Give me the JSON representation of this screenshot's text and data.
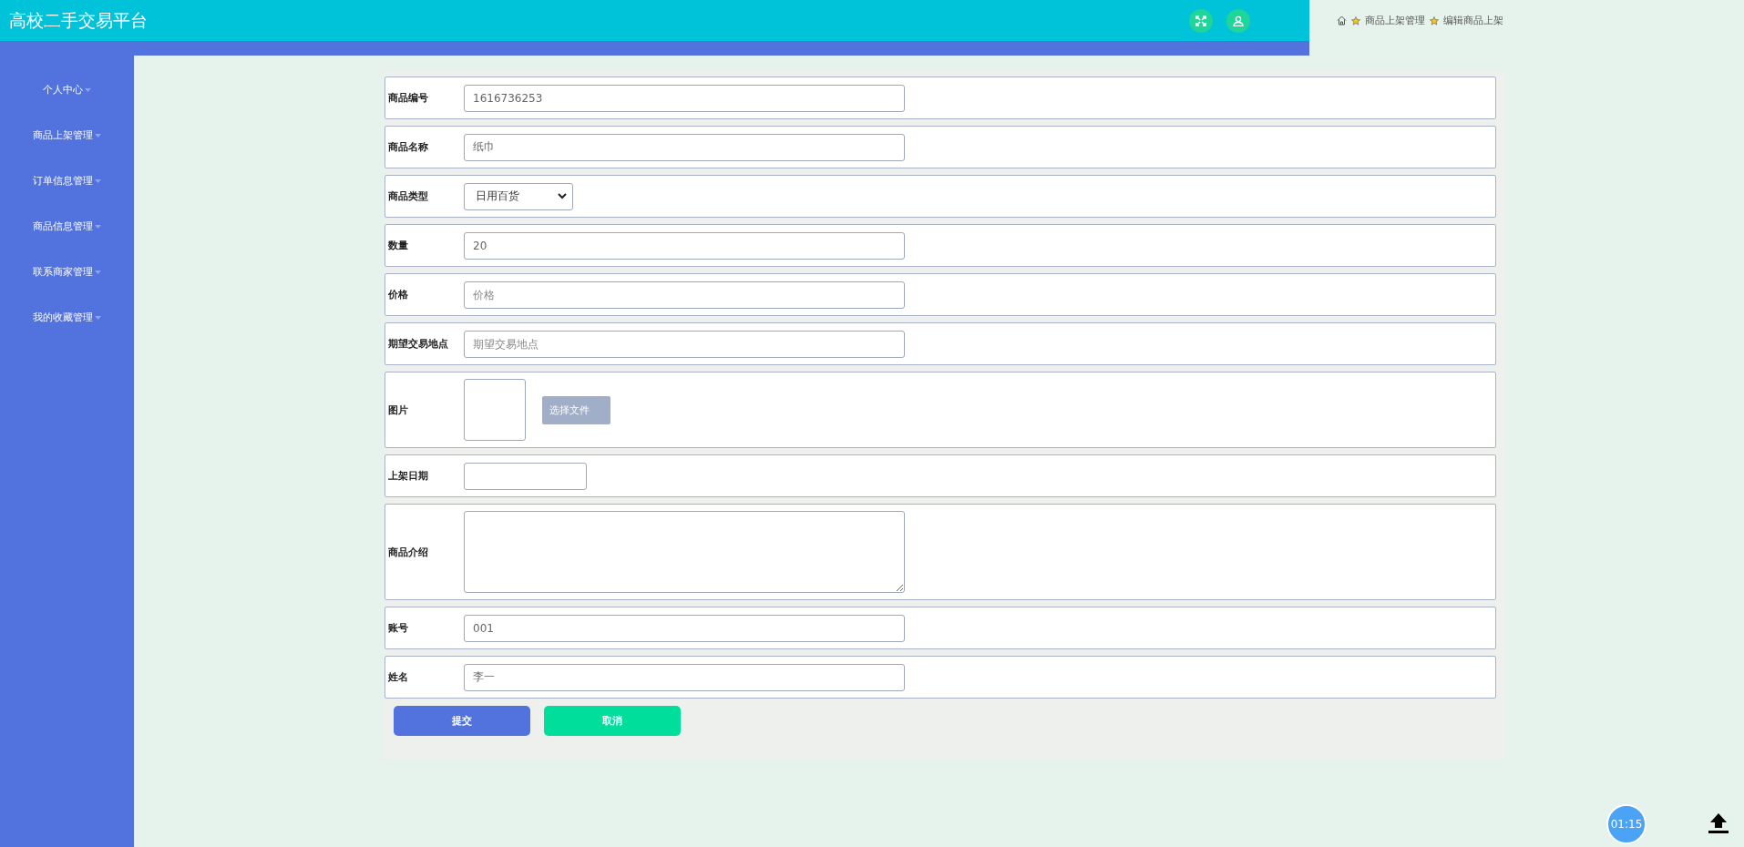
{
  "header": {
    "title": "高校二手交易平台"
  },
  "breadcrumb": [
    "商品上架管理",
    "编辑商品上架"
  ],
  "sidebar": {
    "items": [
      {
        "label": "个人中心"
      },
      {
        "label": "商品上架管理"
      },
      {
        "label": "订单信息管理"
      },
      {
        "label": "商品信息管理"
      },
      {
        "label": "联系商家管理"
      },
      {
        "label": "我的收藏管理"
      }
    ]
  },
  "form": {
    "fields": [
      {
        "kind": "text",
        "label": "商品编号",
        "value": "1616736253"
      },
      {
        "kind": "text",
        "label": "商品名称",
        "value": "纸巾"
      },
      {
        "kind": "select",
        "label": "商品类型",
        "value": "日用百货"
      },
      {
        "kind": "text",
        "label": "数量",
        "value": "20"
      },
      {
        "kind": "text",
        "label": "价格",
        "placeholder": "价格"
      },
      {
        "kind": "text",
        "label": "期望交易地点",
        "placeholder": "期望交易地点"
      },
      {
        "kind": "image",
        "label": "图片",
        "button": "选择文件"
      },
      {
        "kind": "date",
        "label": "上架日期"
      },
      {
        "kind": "textarea",
        "label": "商品介绍"
      },
      {
        "kind": "text",
        "label": "账号",
        "value": "001"
      },
      {
        "kind": "text",
        "label": "姓名",
        "value": "李一"
      }
    ],
    "buttons": [
      {
        "kind": "submit",
        "label": "提交"
      },
      {
        "kind": "cancel",
        "label": "取消"
      }
    ]
  },
  "timer": "01:15"
}
